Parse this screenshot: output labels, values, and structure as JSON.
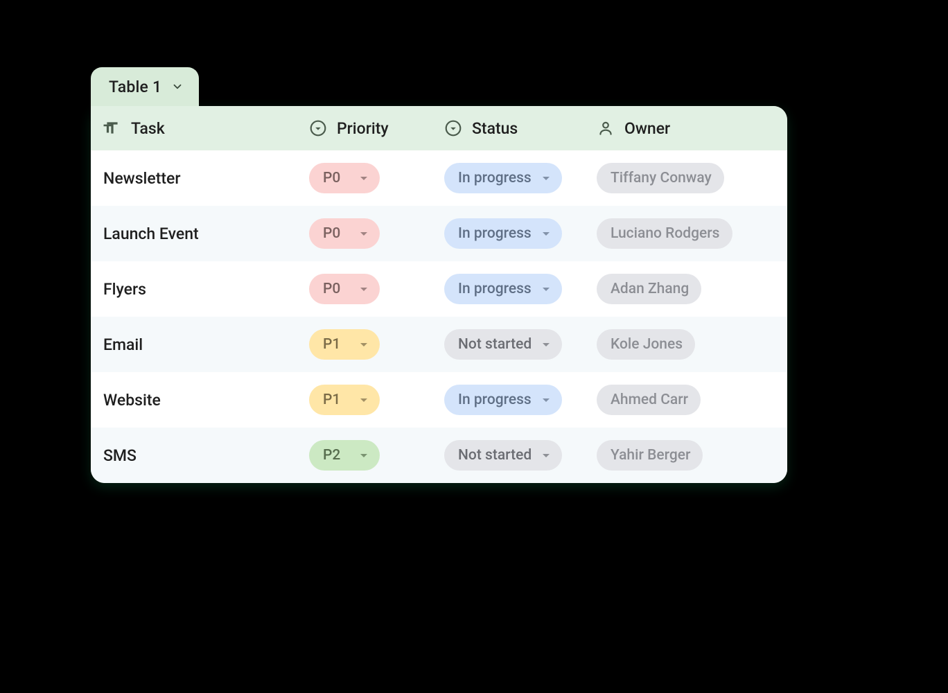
{
  "tab": {
    "label": "Table 1"
  },
  "columns": {
    "task": {
      "label": "Task"
    },
    "prio": {
      "label": "Priority"
    },
    "status": {
      "label": "Status"
    },
    "owner": {
      "label": "Owner"
    }
  },
  "priorityClasses": {
    "P0": "prio-P0",
    "P1": "prio-P1",
    "P2": "prio-P2"
  },
  "statusClasses": {
    "In progress": "status-inprogress",
    "Not started": "status-notstarted"
  },
  "rows": [
    {
      "task": "Newsletter",
      "priority": "P0",
      "status": "In progress",
      "owner": "Tiffany Conway"
    },
    {
      "task": "Launch Event",
      "priority": "P0",
      "status": "In progress",
      "owner": "Luciano Rodgers"
    },
    {
      "task": "Flyers",
      "priority": "P0",
      "status": "In progress",
      "owner": "Adan Zhang"
    },
    {
      "task": "Email",
      "priority": "P1",
      "status": "Not started",
      "owner": "Kole Jones"
    },
    {
      "task": "Website",
      "priority": "P1",
      "status": "In progress",
      "owner": "Ahmed Carr"
    },
    {
      "task": "SMS",
      "priority": "P2",
      "status": "Not started",
      "owner": "Yahir Berger"
    }
  ]
}
